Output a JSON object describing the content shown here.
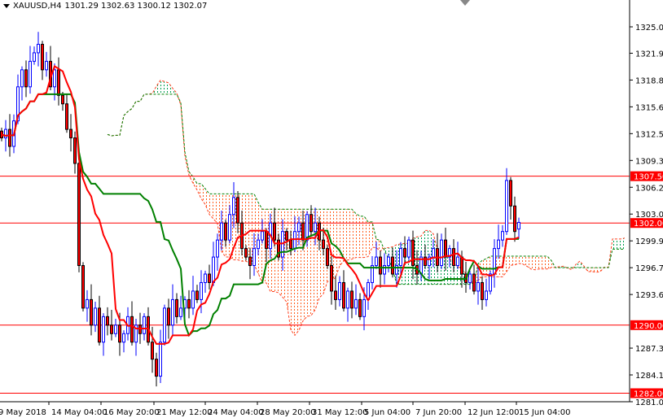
{
  "header": {
    "symbol": "XAUUSD,H4",
    "ohlc": "1301.29 1302.63 1300.12 1302.07"
  },
  "colors": {
    "bull": "#0000ff",
    "bear": "#ff0000",
    "tenkan": "#ff0000",
    "kijun": "#008000",
    "cloud_up": "#00a050",
    "cloud_down": "#ff6020",
    "level": "#ff0000"
  },
  "chart_data": {
    "type": "candlestick",
    "title": "XAUUSD,H4",
    "ylim": [
      1281.0,
      1325.05
    ],
    "y_ticks": [
      "1325.05",
      "1321.95",
      "1318.80",
      "1315.65",
      "1312.50",
      "1309.35",
      "1306.20",
      "1303.05",
      "1299.90",
      "1296.75",
      "1293.60",
      "1287.30",
      "1284.15",
      "1281.00"
    ],
    "x_labels": [
      "9 May 2018",
      "14 May 04:00",
      "16 May 20:00",
      "21 May 12:00",
      "24 May 04:00",
      "28 May 20:00",
      "31 May 12:00",
      "5 Jun 04:00",
      "7 Jun 20:00",
      "12 Jun 12:00",
      "15 Jun 04:00"
    ],
    "levels": [
      {
        "value": 1307.5,
        "label": "1307.50"
      },
      {
        "value": 1302.0,
        "label": "1302.00"
      },
      {
        "value": 1290.0,
        "label": "1290.00"
      },
      {
        "value": 1282.0,
        "label": "1282.00"
      }
    ],
    "indicator": "Ichimoku (9, 26, 52)",
    "closes": [
      1312,
      1313,
      1311,
      1314,
      1318,
      1320,
      1318,
      1321,
      1322,
      1323,
      1320,
      1321,
      1318,
      1320,
      1317,
      1316,
      1313,
      1312,
      1309,
      1297,
      1292,
      1293,
      1290,
      1292,
      1288,
      1291,
      1290,
      1289,
      1290,
      1288,
      1289,
      1291,
      1288,
      1290,
      1289,
      1291,
      1288,
      1286,
      1284,
      1288,
      1292,
      1290,
      1293,
      1291,
      1292,
      1293,
      1292,
      1294,
      1293,
      1295,
      1296,
      1295,
      1298,
      1300,
      1302,
      1300,
      1303,
      1305,
      1302,
      1299,
      1298,
      1297,
      1299,
      1300,
      1301,
      1299,
      1302,
      1300,
      1298,
      1301,
      1300,
      1299,
      1301,
      1302,
      1300,
      1303,
      1301,
      1302,
      1300,
      1299,
      1297,
      1294,
      1293,
      1295,
      1292,
      1294,
      1292,
      1293,
      1291,
      1293,
      1295,
      1297,
      1298,
      1296,
      1297,
      1298,
      1296,
      1297,
      1299,
      1298,
      1300,
      1297,
      1296,
      1298,
      1297,
      1298,
      1299,
      1297,
      1300,
      1298,
      1299,
      1297,
      1298,
      1296,
      1295,
      1296,
      1294,
      1295,
      1293,
      1294,
      1296,
      1299,
      1300,
      1301,
      1307,
      1304,
      1301,
      1302.07
    ]
  }
}
